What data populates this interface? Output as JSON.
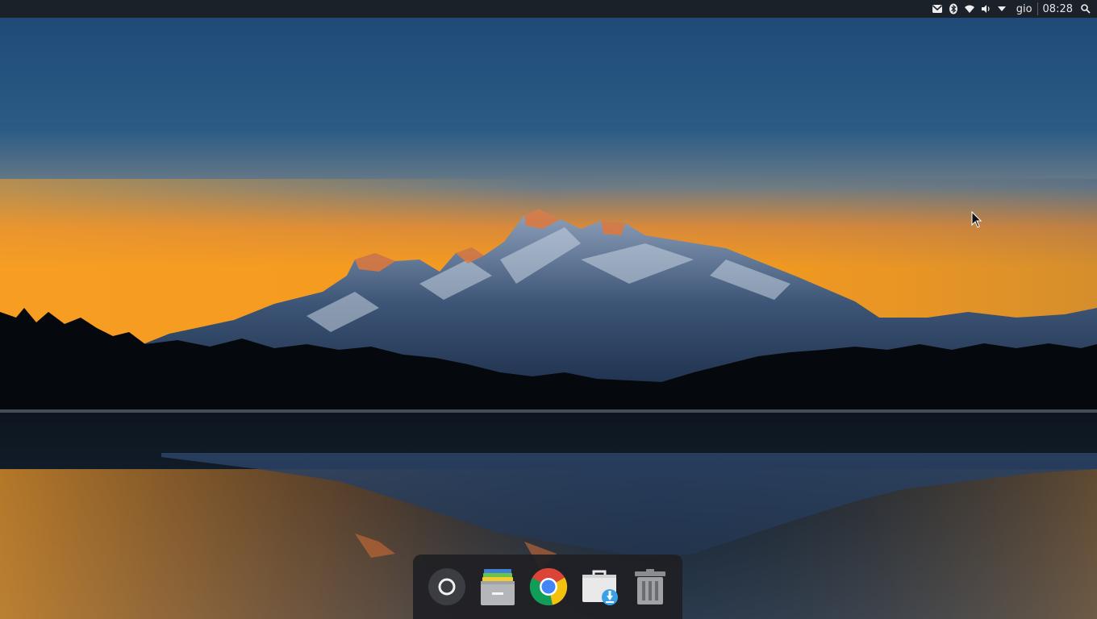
{
  "topbar": {
    "user": "gio",
    "clock": "08:28",
    "tray_icons": [
      "mail-icon",
      "bluetooth-icon",
      "wifi-icon",
      "volume-icon",
      "dropdown-arrow-icon",
      "search-icon"
    ]
  },
  "dock": {
    "items": [
      "launcher-icon",
      "files-icon",
      "chrome-icon",
      "software-center-icon",
      "trash-icon"
    ]
  },
  "colors": {
    "panel": "#1b2128",
    "dock": "#202024",
    "sky_top": "#1f4d7a",
    "sunset": "#f59a1f"
  }
}
